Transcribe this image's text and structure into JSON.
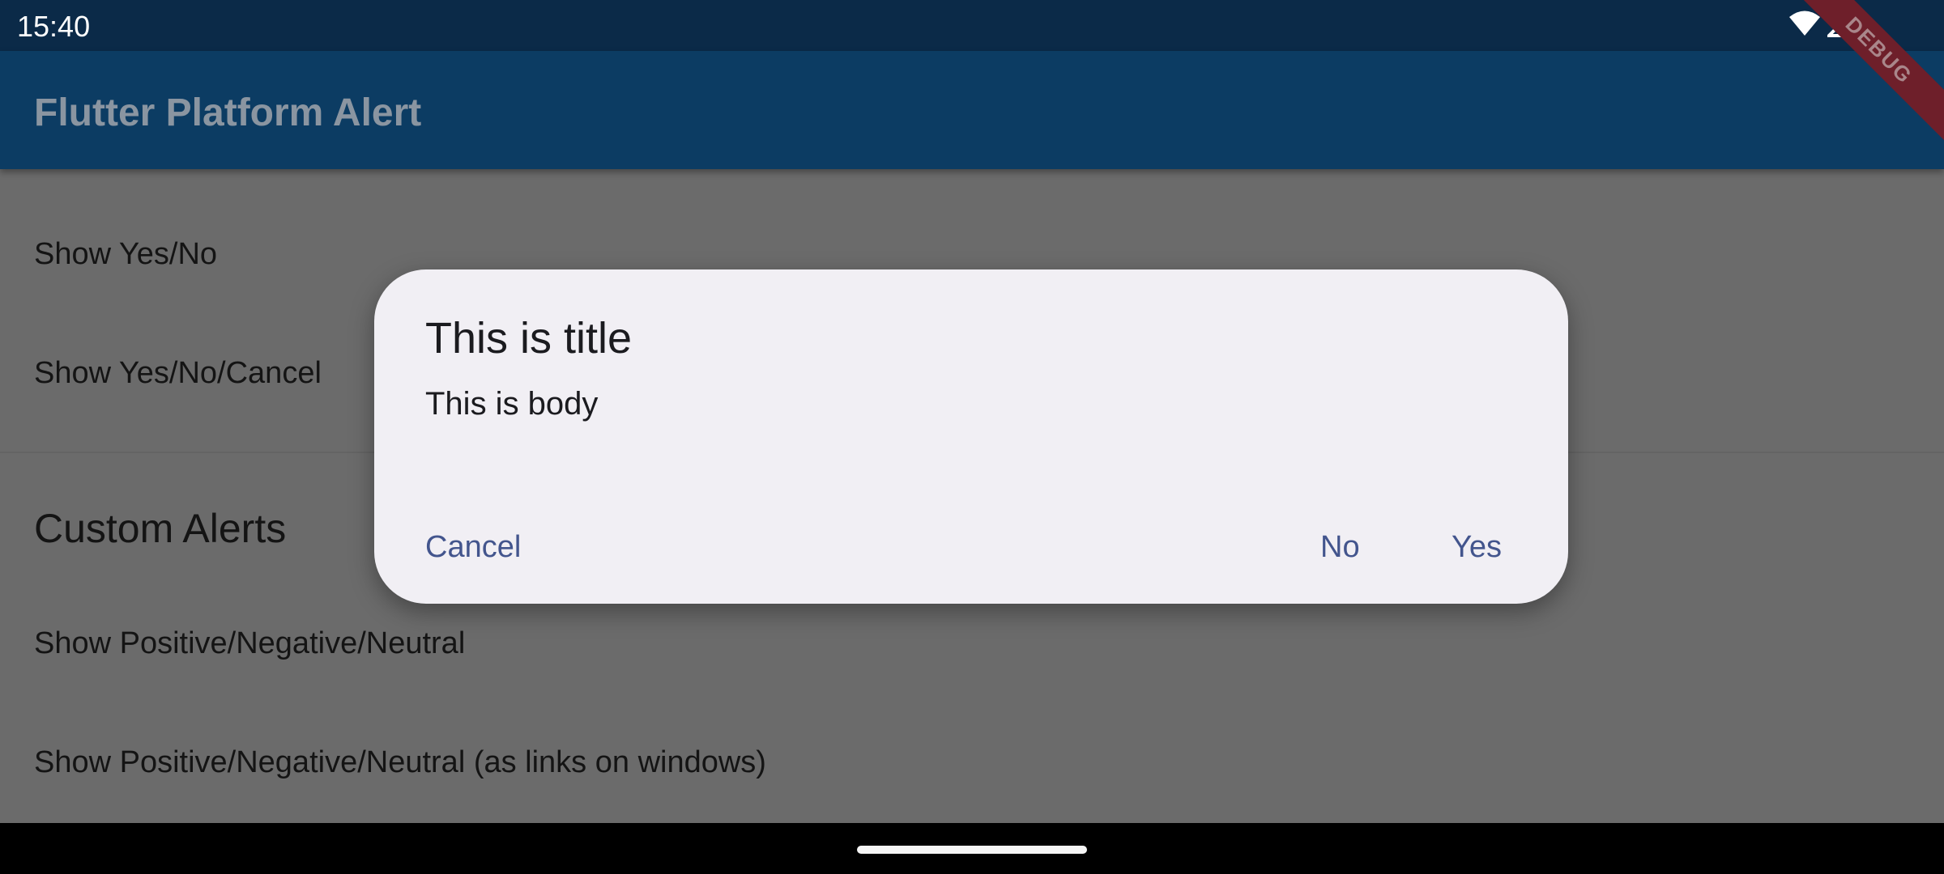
{
  "status_bar": {
    "time": "15:40"
  },
  "app_bar": {
    "title": "Flutter Platform Alert",
    "debug_label": "DEBUG"
  },
  "list": {
    "items": [
      "Show Yes/No",
      "Show Yes/No/Cancel"
    ],
    "section_title": "Custom Alerts",
    "custom_items": [
      "Show Positive/Negative/Neutral",
      "Show Positive/Negative/Neutral (as links on windows)"
    ]
  },
  "dialog": {
    "title": "This is title",
    "body": "This is body",
    "cancel_label": "Cancel",
    "no_label": "No",
    "yes_label": "Yes"
  },
  "colors": {
    "status_bar": "#0b2a48",
    "app_bar": "#0c3c63",
    "dialog_bg": "#f1eff4",
    "button_text": "#43558d"
  }
}
